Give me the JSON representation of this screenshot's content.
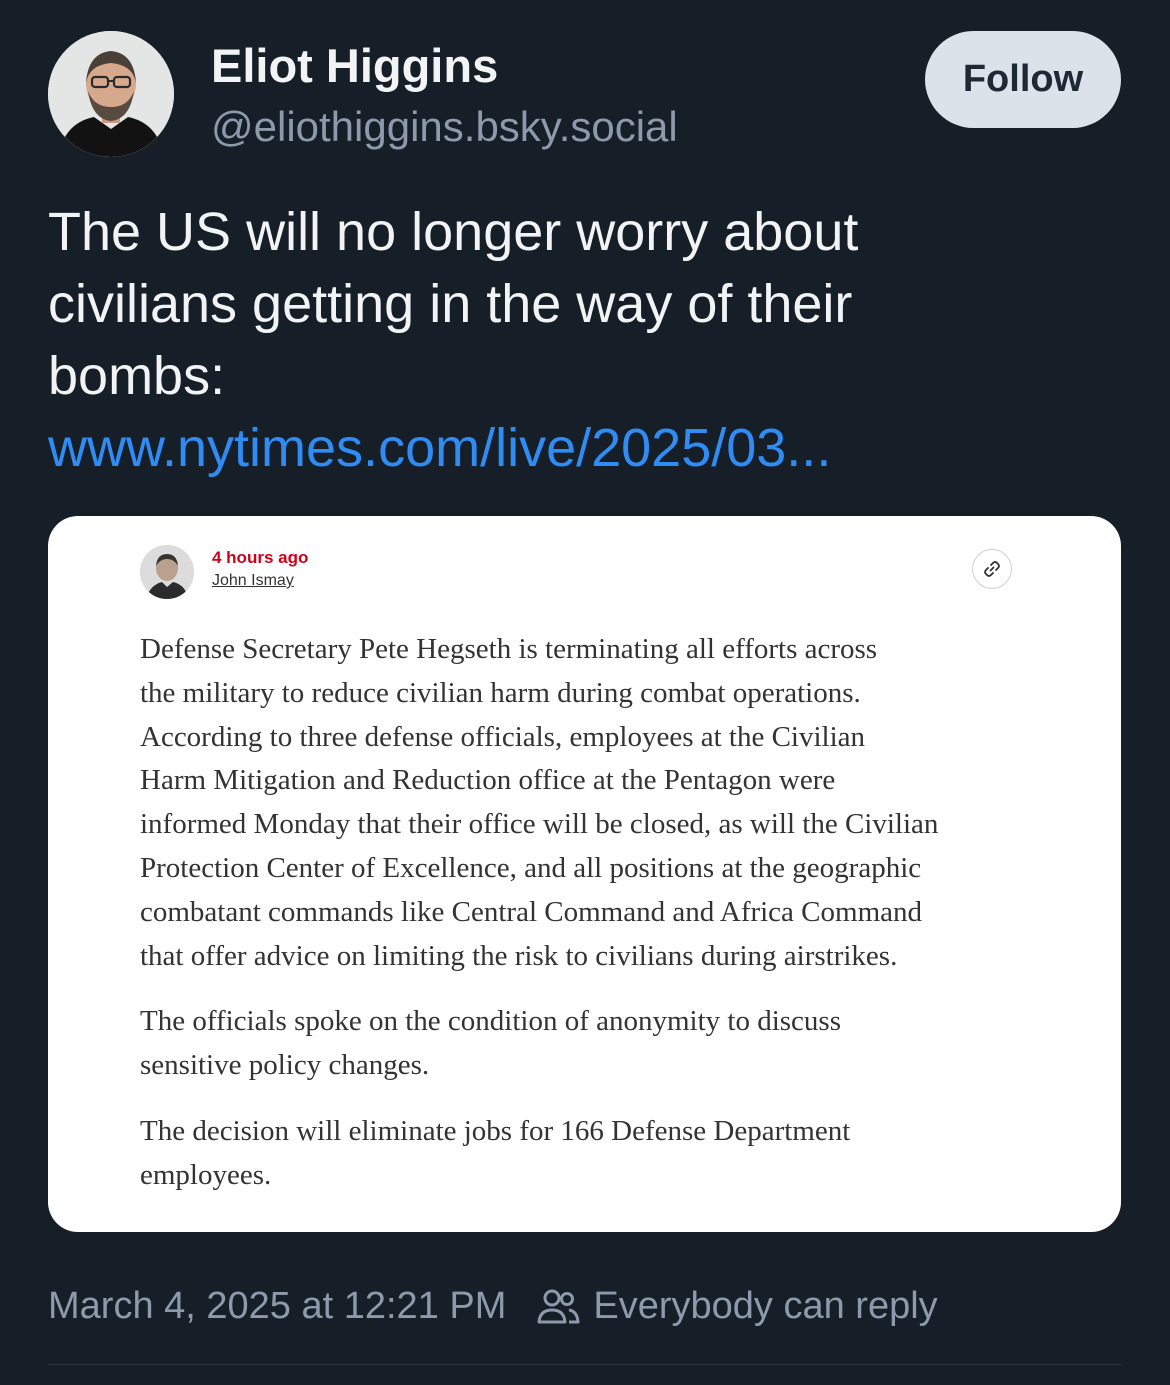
{
  "post": {
    "author": {
      "name": "Eliot Higgins",
      "handle": "@eliothiggins.bsky.social"
    },
    "follow_label": "Follow",
    "text_lines": [
      "The US will no longer worry about",
      "civilians getting in the way of their",
      "bombs:"
    ],
    "link_text": "www.nytimes.com/live/2025/03...",
    "footer": {
      "timestamp": "March 4, 2025 at 12:21 PM",
      "reply_setting": "Everybody can reply"
    }
  },
  "embed": {
    "time_ago": "4 hours ago",
    "reporter": "John Ismay",
    "paragraphs": [
      [
        "Defense Secretary Pete Hegseth is terminating all efforts across",
        "the military to reduce civilian harm during combat operations.",
        "According to three defense officials, employees at the Civilian",
        "Harm Mitigation and Reduction office at the Pentagon were",
        "informed Monday that their office will be closed, as will the Civilian",
        "Protection Center of Excellence, and all positions at the geographic",
        "combatant commands like Central Command and Africa Command",
        "that offer advice on limiting the risk to civilians during airstrikes."
      ],
      [
        "The officials spoke on the condition of anonymity to discuss",
        "sensitive policy changes."
      ],
      [
        "The decision will eliminate jobs for 166 Defense Department",
        "employees."
      ]
    ]
  },
  "colors": {
    "background": "#161e27",
    "link": "#2f8cf5",
    "muted": "#8c9aab",
    "nyt_red": "#d0021b"
  }
}
